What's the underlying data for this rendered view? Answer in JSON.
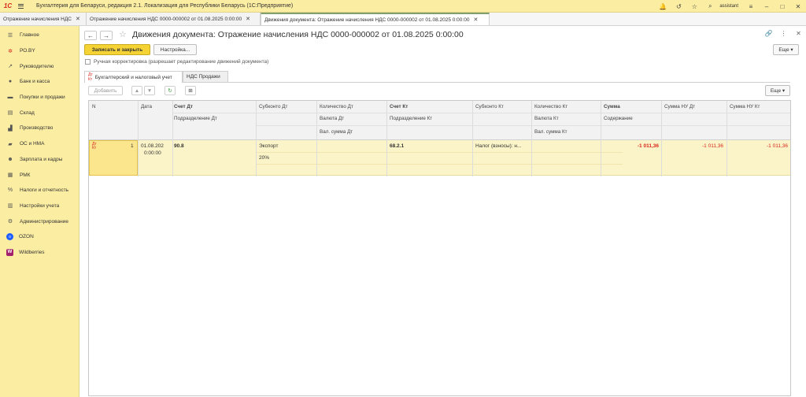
{
  "app": {
    "title": "Бухгалтерия для Беларуси, редакция 2.1. Локализация для Республики Беларусь   (1С:Предприятие)",
    "user": "assistant",
    "logo_text": "1С"
  },
  "open_tabs": [
    {
      "label": "Отражение начисления НДС"
    },
    {
      "label": "Отражение начисления НДС 0000-000002 от 01.08.2025 0:00:00"
    },
    {
      "label": "Движения документа: Отражение начисления НДС 0000-000002 от 01.08.2025 0:00:00"
    }
  ],
  "sidebar": {
    "items": [
      {
        "label": "Главное",
        "icon": "menu-icon"
      },
      {
        "label": "РО.BY",
        "icon": "po-icon"
      },
      {
        "label": "Руководителю",
        "icon": "chart-icon"
      },
      {
        "label": "Банк и касса",
        "icon": "bank-icon"
      },
      {
        "label": "Покупки и продажи",
        "icon": "cart-icon"
      },
      {
        "label": "Склад",
        "icon": "warehouse-icon"
      },
      {
        "label": "Производство",
        "icon": "factory-icon"
      },
      {
        "label": "ОС и НМА",
        "icon": "truck-icon"
      },
      {
        "label": "Зарплата и кадры",
        "icon": "people-icon"
      },
      {
        "label": "РМК",
        "icon": "cash-register-icon"
      },
      {
        "label": "Налоги и отчетность",
        "icon": "tax-icon"
      },
      {
        "label": "Настройки учета",
        "icon": "settings-doc-icon"
      },
      {
        "label": "Администрирование",
        "icon": "gear-icon"
      },
      {
        "label": "OZON",
        "icon": "ozon-icon"
      },
      {
        "label": "Wildberries",
        "icon": "wildberries-icon"
      }
    ]
  },
  "document": {
    "title": "Движения документа: Отражение начисления НДС 0000-000002 от 01.08.2025 0:00:00",
    "save_close": "Записать и закрыть",
    "settings": "Настройка...",
    "more": "Еще",
    "manual_correction": "Ручная корректировка (разрешает редактирование движений документа)",
    "form_tabs": [
      "Бухгалтерский и налоговый учет",
      "НДС Продажи"
    ],
    "add_button": "Добавить",
    "table_more": "Еще"
  },
  "table": {
    "headers": {
      "n": "N",
      "date": "Дата",
      "debit_account": "Счет Дт",
      "debit_department": "Подразделение Дт",
      "subconto_dt": "Субконто Дт",
      "qty_dt": "Количество Дт",
      "currency_dt": "Валюта Дт",
      "cur_sum_dt": "Вал. сумма Дт",
      "credit_account": "Счет Кт",
      "credit_department": "Подразделение Кт",
      "subconto_kt": "Субконто Кт",
      "qty_kt": "Количество Кт",
      "currency_kt": "Валюта Кт",
      "cur_sum_kt": "Вал. сумма Кт",
      "sum": "Сумма",
      "content": "Содержание",
      "sum_nu_dt": "Сумма НУ Дт",
      "sum_nu_kt": "Сумма НУ Кт"
    },
    "rows": [
      {
        "icon": "dt-kt-icon",
        "n": "1",
        "date_line1": "01.08.202",
        "date_line2": "0:00:00",
        "debit_account": "90.8",
        "subconto_dt_1": "Экспорт",
        "subconto_dt_2": "20%",
        "credit_account": "68.2.1",
        "subconto_kt_1": "Налог (взносы): н...",
        "sum": "-1 011,36",
        "sum_nu_dt": "-1 011,36",
        "sum_nu_kt": "-1 011,36"
      }
    ]
  }
}
